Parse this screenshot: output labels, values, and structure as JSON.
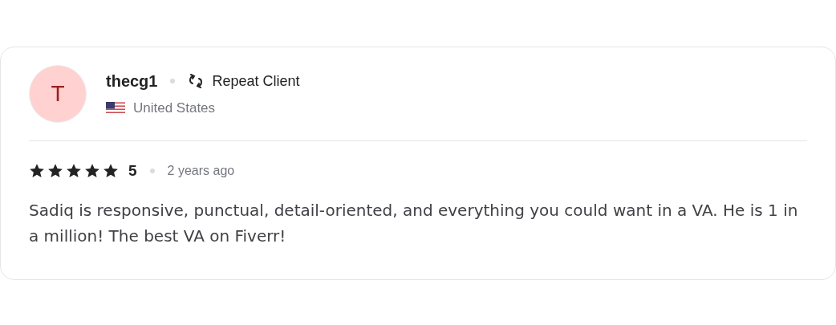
{
  "review": {
    "avatar_initial": "T",
    "username": "thecg1",
    "badge": "Repeat Client",
    "country": "United States",
    "stars": 5,
    "rating": "5",
    "time": "2 years ago",
    "text": "Sadiq is responsive, punctual, detail-oriented, and everything you could want in a VA. He is 1 in a million! The best VA on Fiverr!"
  }
}
